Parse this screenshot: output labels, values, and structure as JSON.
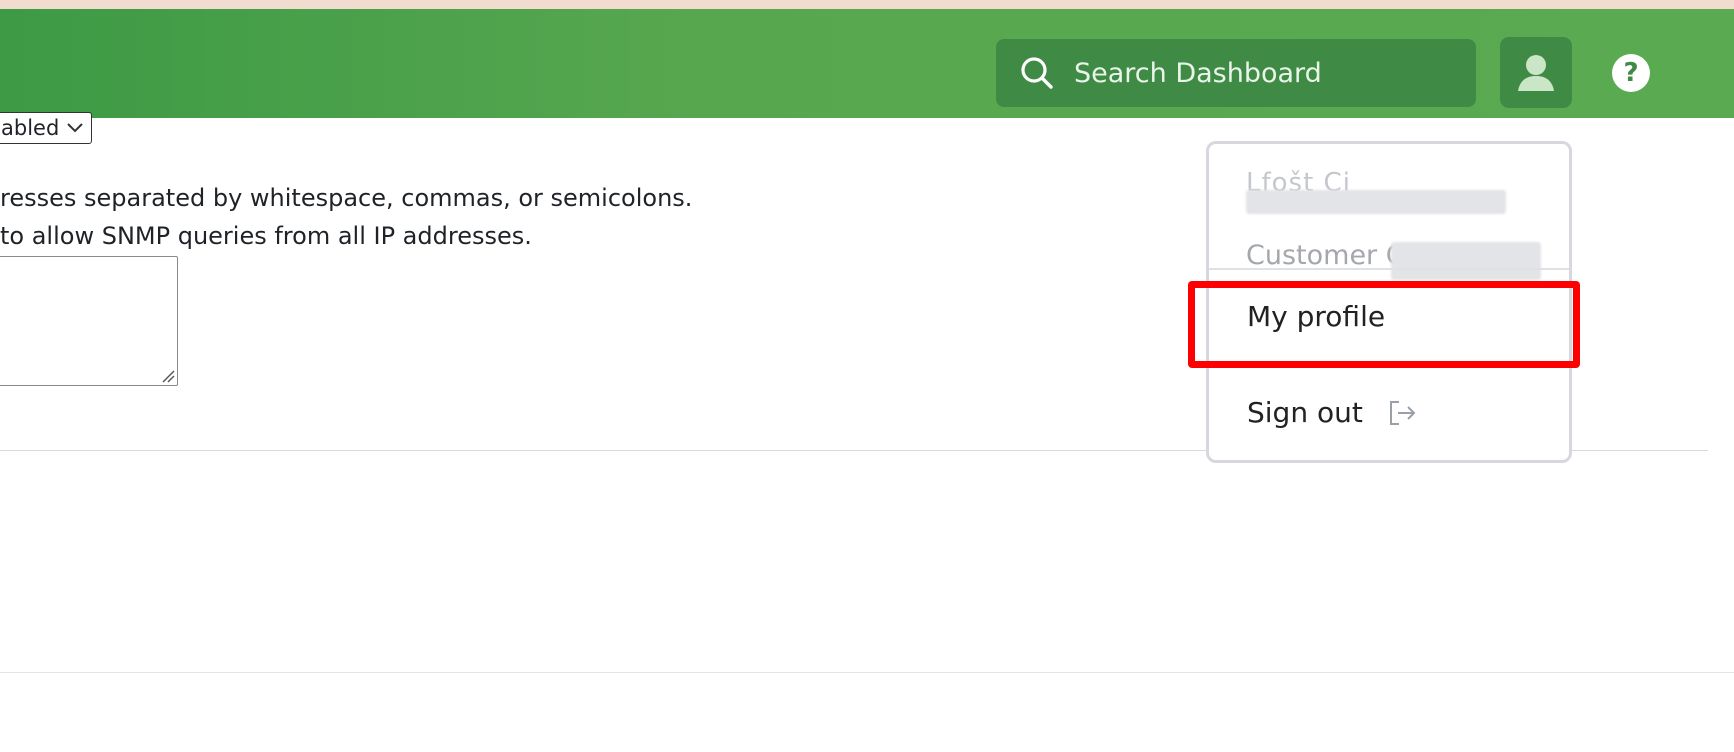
{
  "header": {
    "search_placeholder": "Search Dashboard",
    "help_label": "?"
  },
  "form": {
    "select_value": "abled",
    "help_text_line1": "resses separated by whitespace, commas, or semicolons.",
    "help_text_line2": " to allow SNMP queries from all IP addresses.",
    "textarea_value": ""
  },
  "user_menu": {
    "name": "Lfošt Ci",
    "customer_label": "Customer C",
    "items": [
      {
        "label": "My profile"
      },
      {
        "label": "Sign out",
        "icon": "sign-out-icon"
      }
    ]
  },
  "colors": {
    "header_green": "#5aaa52",
    "search_bg": "#3f8a45",
    "highlight": "#ff0000"
  }
}
